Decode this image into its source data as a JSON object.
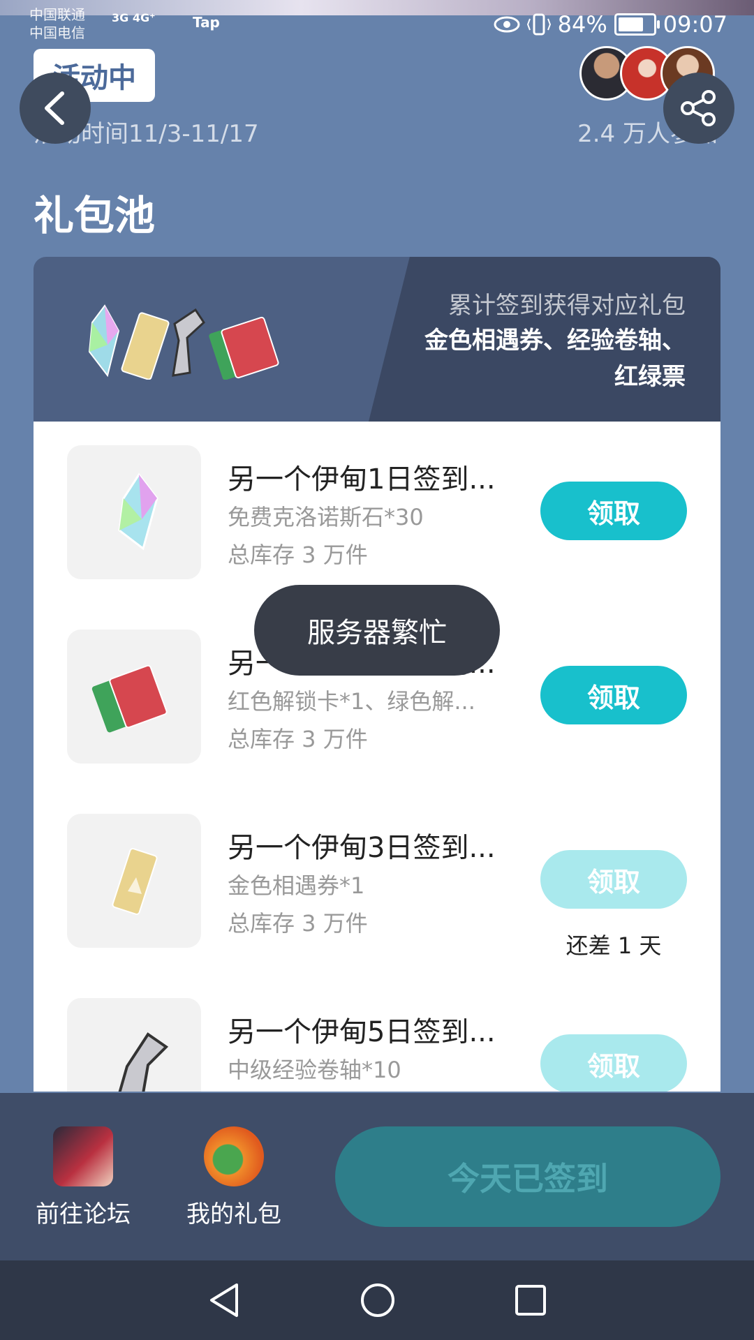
{
  "status_bar": {
    "carrier_1": "中国联通",
    "carrier_2": "中国电信",
    "network": "3G 4G⁺",
    "tap": "Tap",
    "battery_percent": "84%",
    "battery_level": 0.84,
    "time": "09:07"
  },
  "event": {
    "status_badge": "活动中",
    "date_range": "活动时间11/3-11/17",
    "participants": "2.4 万人参加"
  },
  "section_title": "礼包池",
  "header": {
    "subtitle": "累计签到获得对应礼包",
    "items_line1": "金色相遇券、经验卷轴、",
    "items_line2": "红绿票"
  },
  "gifts": [
    {
      "title": "另一个伊甸1日签到...",
      "desc": "免费克洛诺斯石*30",
      "stock": "总库存 3 万件",
      "button": "领取",
      "icon": "crystal-icon",
      "enabled": true,
      "days_left": ""
    },
    {
      "title": "另一个伊甸2日签到...",
      "desc": "红色解锁卡*1、绿色解...",
      "stock": "总库存 3 万件",
      "button": "领取",
      "icon": "cards-icon",
      "enabled": true,
      "days_left": ""
    },
    {
      "title": "另一个伊甸3日签到...",
      "desc": "金色相遇券*1",
      "stock": "总库存 3 万件",
      "button": "领取",
      "icon": "ticket-icon",
      "enabled": false,
      "days_left": "还差 1 天"
    },
    {
      "title": "另一个伊甸5日签到...",
      "desc": "中级经验卷轴*10",
      "stock": "",
      "button": "领取",
      "icon": "scroll-icon",
      "enabled": false,
      "days_left": ""
    }
  ],
  "toast": "服务器繁忙",
  "bottom": {
    "forum_label": "前往论坛",
    "my_gifts_label": "我的礼包",
    "checkin_label": "今天已签到"
  },
  "colors": {
    "accent": "#18c0cc",
    "accent_disabled": "#a9e9ed",
    "background": "#6682ab"
  }
}
